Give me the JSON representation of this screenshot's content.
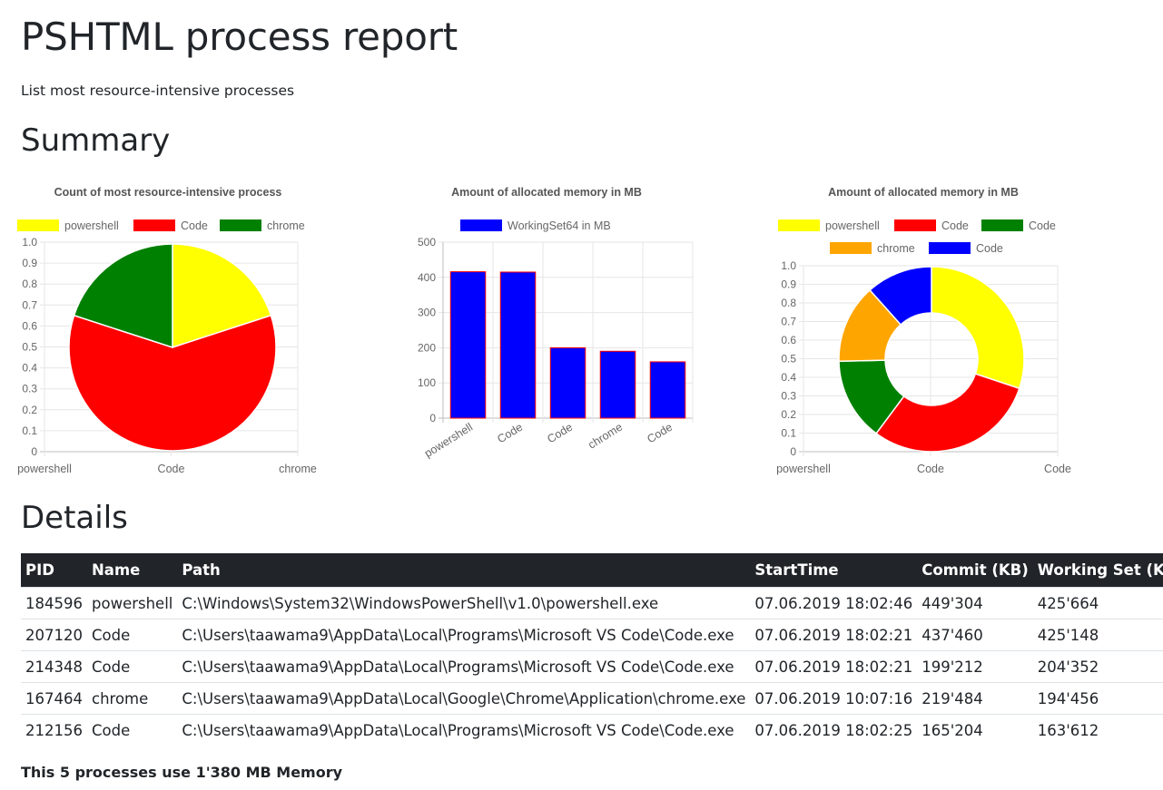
{
  "page": {
    "title": "PSHTML process report",
    "subtitle": "List most resource-intensive processes",
    "summary_heading": "Summary",
    "details_heading": "Details",
    "footer": "This 5 processes use 1'380 MB Memory"
  },
  "chart_data": [
    {
      "type": "pie",
      "title": "Count of most resource-intensive process",
      "categories": [
        "powershell",
        "Code",
        "chrome"
      ],
      "values": [
        1,
        3,
        1
      ],
      "colors": [
        "#ffff00",
        "#ff0000",
        "#008000"
      ],
      "legend": "top",
      "ytick_labels": [
        "1.0",
        "0.9",
        "0.8",
        "0.7",
        "0.6",
        "0.5",
        "0.4",
        "0.3",
        "0.2",
        "0.1",
        "0"
      ],
      "ylim": [
        0,
        1
      ],
      "grid": true
    },
    {
      "type": "bar",
      "title": "Amount of allocated memory in MB",
      "categories": [
        "powershell",
        "Code",
        "Code",
        "chrome",
        "Code"
      ],
      "series": [
        {
          "name": "WorkingSet64 in MB",
          "values": [
            416,
            415,
            200,
            190,
            160
          ],
          "color": "#0000ff",
          "border_color": "#ff0000"
        }
      ],
      "ytick_labels": [
        "500",
        "400",
        "300",
        "200",
        "100",
        "0"
      ],
      "ylim": [
        0,
        500
      ],
      "legend": "top",
      "grid": true
    },
    {
      "type": "pie",
      "variant": "doughnut",
      "title": "Amount of allocated memory in MB",
      "categories": [
        "powershell",
        "Code",
        "Code",
        "chrome",
        "Code"
      ],
      "values": [
        416,
        415,
        200,
        190,
        160
      ],
      "colors": [
        "#ffff00",
        "#ff0000",
        "#008000",
        "#ffa500",
        "#0000ff"
      ],
      "xtick_labels": [
        "powershell",
        "Code",
        "Code"
      ],
      "ytick_labels": [
        "1.0",
        "0.9",
        "0.8",
        "0.7",
        "0.6",
        "0.5",
        "0.4",
        "0.3",
        "0.2",
        "0.1",
        "0"
      ],
      "ylim": [
        0,
        1
      ],
      "legend": "top",
      "grid": true
    }
  ],
  "table": {
    "headers": [
      "PID",
      "Name",
      "Path",
      "StartTime",
      "Commit (KB)",
      "Working Set (KB)"
    ],
    "rows": [
      [
        "184596",
        "powershell",
        "C:\\Windows\\System32\\WindowsPowerShell\\v1.0\\powershell.exe",
        "07.06.2019 18:02:46",
        "449'304",
        "425'664"
      ],
      [
        "207120",
        "Code",
        "C:\\Users\\taawama9\\AppData\\Local\\Programs\\Microsoft VS Code\\Code.exe",
        "07.06.2019 18:02:21",
        "437'460",
        "425'148"
      ],
      [
        "214348",
        "Code",
        "C:\\Users\\taawama9\\AppData\\Local\\Programs\\Microsoft VS Code\\Code.exe",
        "07.06.2019 18:02:21",
        "199'212",
        "204'352"
      ],
      [
        "167464",
        "chrome",
        "C:\\Users\\taawama9\\AppData\\Local\\Google\\Chrome\\Application\\chrome.exe",
        "07.06.2019 10:07:16",
        "219'484",
        "194'456"
      ],
      [
        "212156",
        "Code",
        "C:\\Users\\taawama9\\AppData\\Local\\Programs\\Microsoft VS Code\\Code.exe",
        "07.06.2019 18:02:25",
        "165'204",
        "163'612"
      ]
    ]
  }
}
